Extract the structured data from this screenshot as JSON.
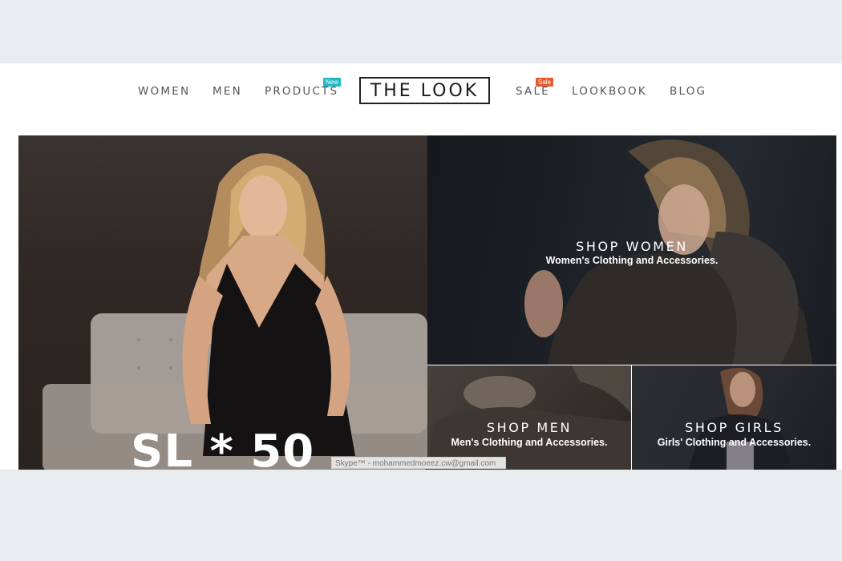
{
  "nav": {
    "items_left": [
      "WOMEN",
      "MEN",
      "PRODUCTS"
    ],
    "items_right": [
      "SALE",
      "LOOKBOOK",
      "BLOG"
    ],
    "products_badge": "New",
    "sale_badge": "Sale",
    "logo_text": "THE LOOK"
  },
  "hero": {
    "promo_text": "SL * 50",
    "women": {
      "title": "SHOP WOMEN",
      "subtitle": "Women's Clothing and Accessories."
    },
    "men": {
      "title": "SHOP MEN",
      "subtitle": "Men's Clothing and Accessories."
    },
    "girls": {
      "title": "SHOP GIRLS",
      "subtitle": "Girls' Clothing and Accessories."
    }
  },
  "overlay": {
    "skype_text": "Skype™ - mohammedmoeez.cw@gmail.com"
  },
  "colors": {
    "new_badge": "#1fb8c8",
    "sale_badge": "#e8592f",
    "nav_text": "#555555",
    "background": "#e9ecee"
  }
}
